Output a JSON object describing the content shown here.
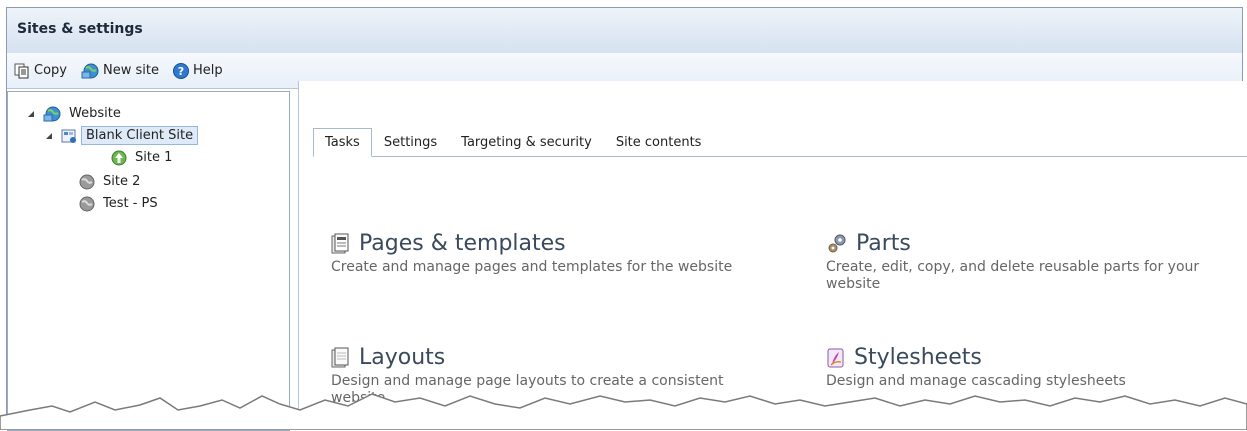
{
  "window": {
    "title": "Sites & settings"
  },
  "toolbar": {
    "copy_label": "Copy",
    "new_site_label": "New site",
    "help_label": "Help"
  },
  "tree": {
    "root": {
      "label": "Website"
    },
    "blank_client_site": {
      "label": "Blank Client Site",
      "selected": true
    },
    "site1": {
      "label": "Site 1"
    },
    "site2": {
      "label": "Site 2"
    },
    "test_ps": {
      "label": "Test - PS"
    }
  },
  "tabs": [
    {
      "label": "Tasks",
      "active": true
    },
    {
      "label": "Settings"
    },
    {
      "label": "Targeting & security"
    },
    {
      "label": "Site contents"
    }
  ],
  "tasks": {
    "pages": {
      "title": "Pages & templates",
      "desc": "Create and manage pages and templates for the website"
    },
    "parts": {
      "title": "Parts",
      "desc": "Create, edit, copy, and delete reusable parts for your website"
    },
    "layouts": {
      "title": "Layouts",
      "desc": "Design and manage page layouts to create a consistent website"
    },
    "stylesheets": {
      "title": "Stylesheets",
      "desc": "Design and manage cascading stylesheets"
    }
  },
  "colors": {
    "accent": "#1d6fc4",
    "selection": "#dfeaf8",
    "border": "#8a9bb3"
  }
}
